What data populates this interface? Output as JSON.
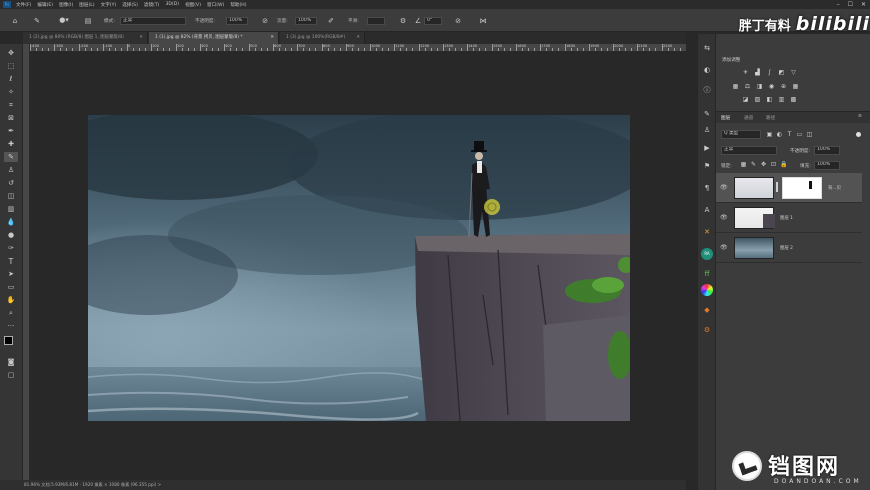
{
  "menubar": {
    "app_icon": "Ps",
    "items": [
      "文件(F)",
      "编辑(E)",
      "图像(I)",
      "图层(L)",
      "文字(Y)",
      "选择(S)",
      "滤镜(T)",
      "3D(D)",
      "视图(V)",
      "窗口(W)",
      "帮助(H)"
    ],
    "controls": [
      "–",
      "☐",
      "✕"
    ]
  },
  "options_bar": {
    "mode_label": "模式:",
    "mode_value": "正常",
    "opacity_label": "不透明度:",
    "opacity_value": "100%",
    "flow_label": "流量:",
    "flow_value": "100%",
    "smooth_label": "平滑:",
    "angle_value": "0°"
  },
  "tabs": [
    {
      "label": "1 (2).jpg @ 80% (RGB/8) 图层 1, 图层蒙版/8)",
      "active": false
    },
    {
      "label": "1 (1).jpg @ 82% (背景 拷贝, 图层蒙版/8) *",
      "active": true
    },
    {
      "label": "1 (3).jpg @ 100%(RGB/8#)",
      "active": false
    }
  ],
  "ruler": {
    "labels": [
      "-400",
      "-300",
      "-200",
      "-100",
      "0",
      "100",
      "200",
      "300",
      "400",
      "500",
      "600",
      "700",
      "800",
      "900",
      "1000",
      "1100",
      "1200",
      "1300",
      "1400",
      "1500",
      "1600",
      "1700",
      "1800",
      "1900",
      "2000",
      "2100",
      "2200"
    ]
  },
  "status": {
    "text": "81.96%    文档:5.93M/6.81M  ·  1920 像素 × 1080 像素 (96.355 ppi)  >"
  },
  "panels": {
    "adjust_title": "添加调整",
    "layers_tabs": [
      "图层",
      "通道",
      "路径"
    ],
    "filter_kind": "Q 类型",
    "blend_mode": "正常",
    "opacity_label": "不透明度:",
    "opacity_value": "100%",
    "lock_label": "锁定:",
    "fill_label": "填充:",
    "fill_value": "100%",
    "layers": [
      {
        "name": "背...贝",
        "selected": true
      },
      {
        "name": "图层 1",
        "selected": false
      },
      {
        "name": "图层 2",
        "selected": false
      }
    ]
  },
  "watermarks": {
    "uploader": "胖丁有料",
    "site_logo": "bilibili",
    "corner_brand": "铛图网",
    "corner_url": "DOANDOAN.COM"
  },
  "colors": {
    "foreground": "#000000",
    "background": "#ffffff",
    "ui_dark": "#282828",
    "panel": "#3c3c3c"
  }
}
